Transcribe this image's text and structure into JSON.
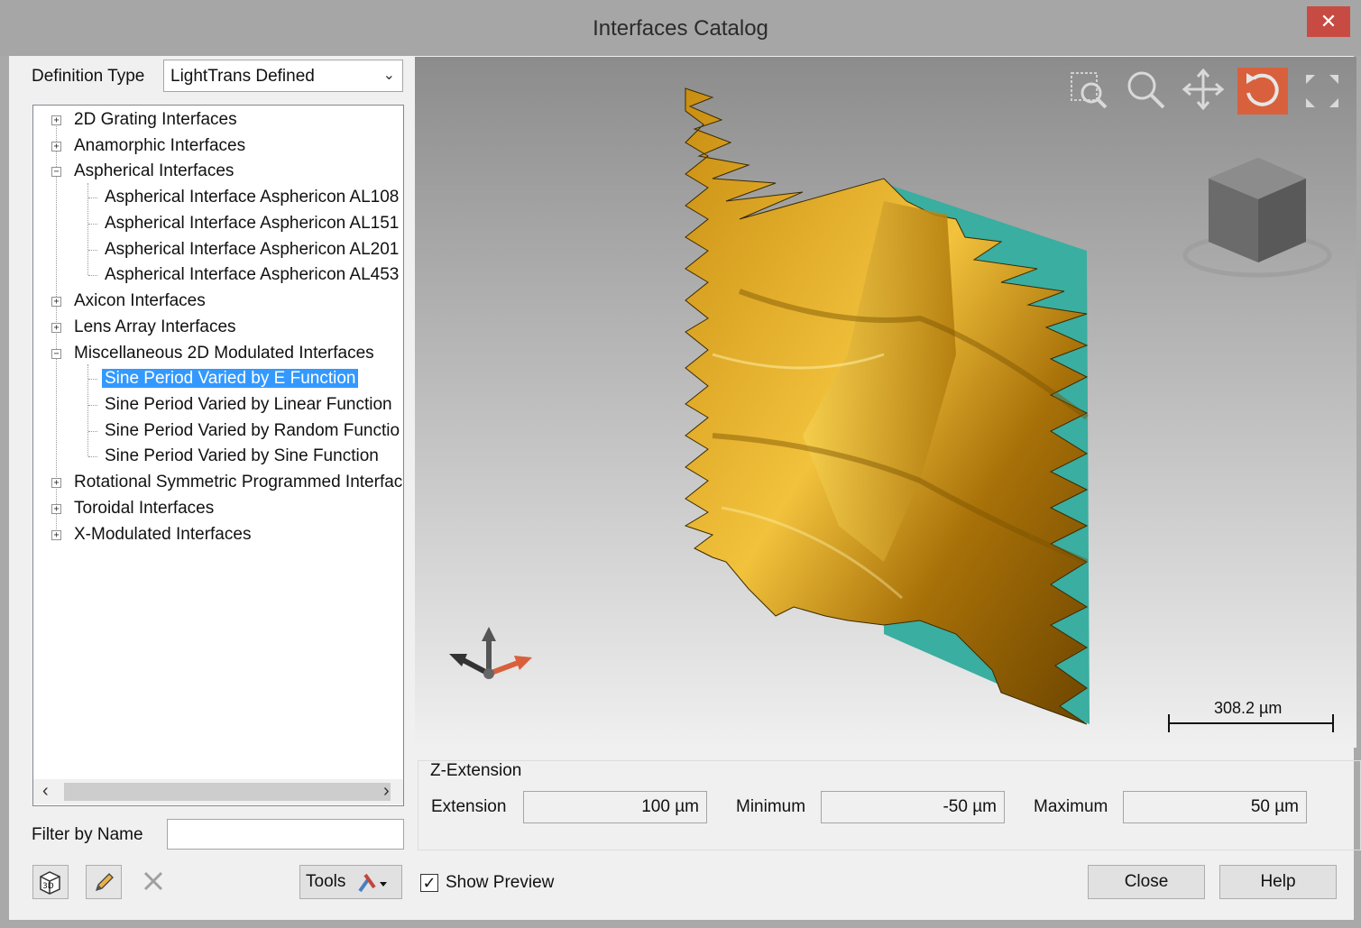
{
  "window": {
    "title": "Interfaces Catalog",
    "close_glyph": "✕"
  },
  "definition_type": {
    "label": "Definition Type",
    "value": "LightTrans Defined"
  },
  "tree": {
    "items": [
      {
        "label": "2D Grating Interfaces",
        "expanded": false
      },
      {
        "label": "Anamorphic Interfaces",
        "expanded": false
      },
      {
        "label": "Aspherical Interfaces",
        "expanded": true,
        "children": [
          "Aspherical Interface Asphericon AL108",
          "Aspherical Interface Asphericon AL151",
          "Aspherical Interface Asphericon AL201",
          "Aspherical Interface Asphericon AL453"
        ]
      },
      {
        "label": "Axicon Interfaces",
        "expanded": false
      },
      {
        "label": "Lens Array Interfaces",
        "expanded": false
      },
      {
        "label": "Miscellaneous 2D Modulated Interfaces",
        "expanded": true,
        "children": [
          "Sine Period Varied by E Function",
          "Sine Period Varied by Linear Function",
          "Sine Period Varied by Random Functio",
          "Sine Period Varied by Sine Function"
        ]
      },
      {
        "label": "Rotational Symmetric Programmed Interface",
        "expanded": false
      },
      {
        "label": "Toroidal Interfaces",
        "expanded": false
      },
      {
        "label": "X-Modulated Interfaces",
        "expanded": false
      }
    ],
    "selected": "Sine Period Varied by E Function"
  },
  "filter": {
    "label": "Filter by Name",
    "value": ""
  },
  "toolbar": {
    "tools_label": "Tools"
  },
  "viewer": {
    "scale_label": "308.2 µm"
  },
  "z_extension": {
    "title": "Z-Extension",
    "extension_label": "Extension",
    "extension_value": "100 µm",
    "minimum_label": "Minimum",
    "minimum_value": "-50 µm",
    "maximum_label": "Maximum",
    "maximum_value": "50 µm"
  },
  "show_preview": {
    "label": "Show Preview",
    "checked": true
  },
  "buttons": {
    "close": "Close",
    "help": "Help"
  },
  "colors": {
    "surface_gold": "#d4a020",
    "surface_teal": "#3aaea0",
    "accent_orange": "#d9603c",
    "selection": "#3399ff"
  }
}
